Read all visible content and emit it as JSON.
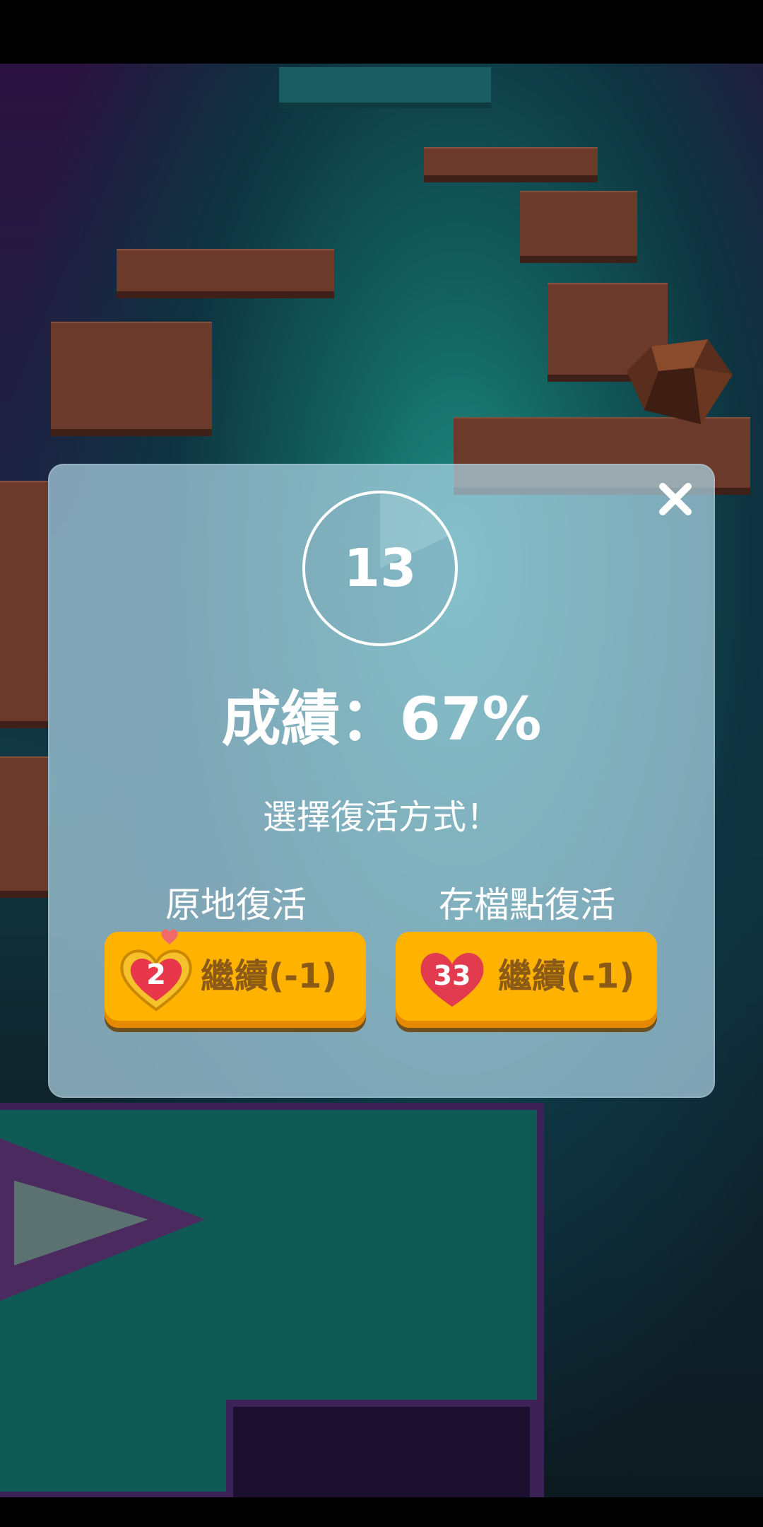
{
  "level": {
    "number": "13"
  },
  "result": {
    "label": "成績：67%",
    "percent": 67
  },
  "revive": {
    "prompt": "選擇復活方式！",
    "options": [
      {
        "label": "原地復活",
        "button_text": "繼續(-1)",
        "heart_count": "2",
        "heart_style": "gold-heart-icon"
      },
      {
        "label": "存檔點復活",
        "button_text": "繼續(-1)",
        "heart_count": "33",
        "heart_style": "red-heart-icon"
      }
    ]
  },
  "colors": {
    "button": "#ffb300",
    "button_text": "#8a5a16",
    "modal": "#acd2e4",
    "tile": "#6b3a2a",
    "heart": "#e23a4f"
  }
}
